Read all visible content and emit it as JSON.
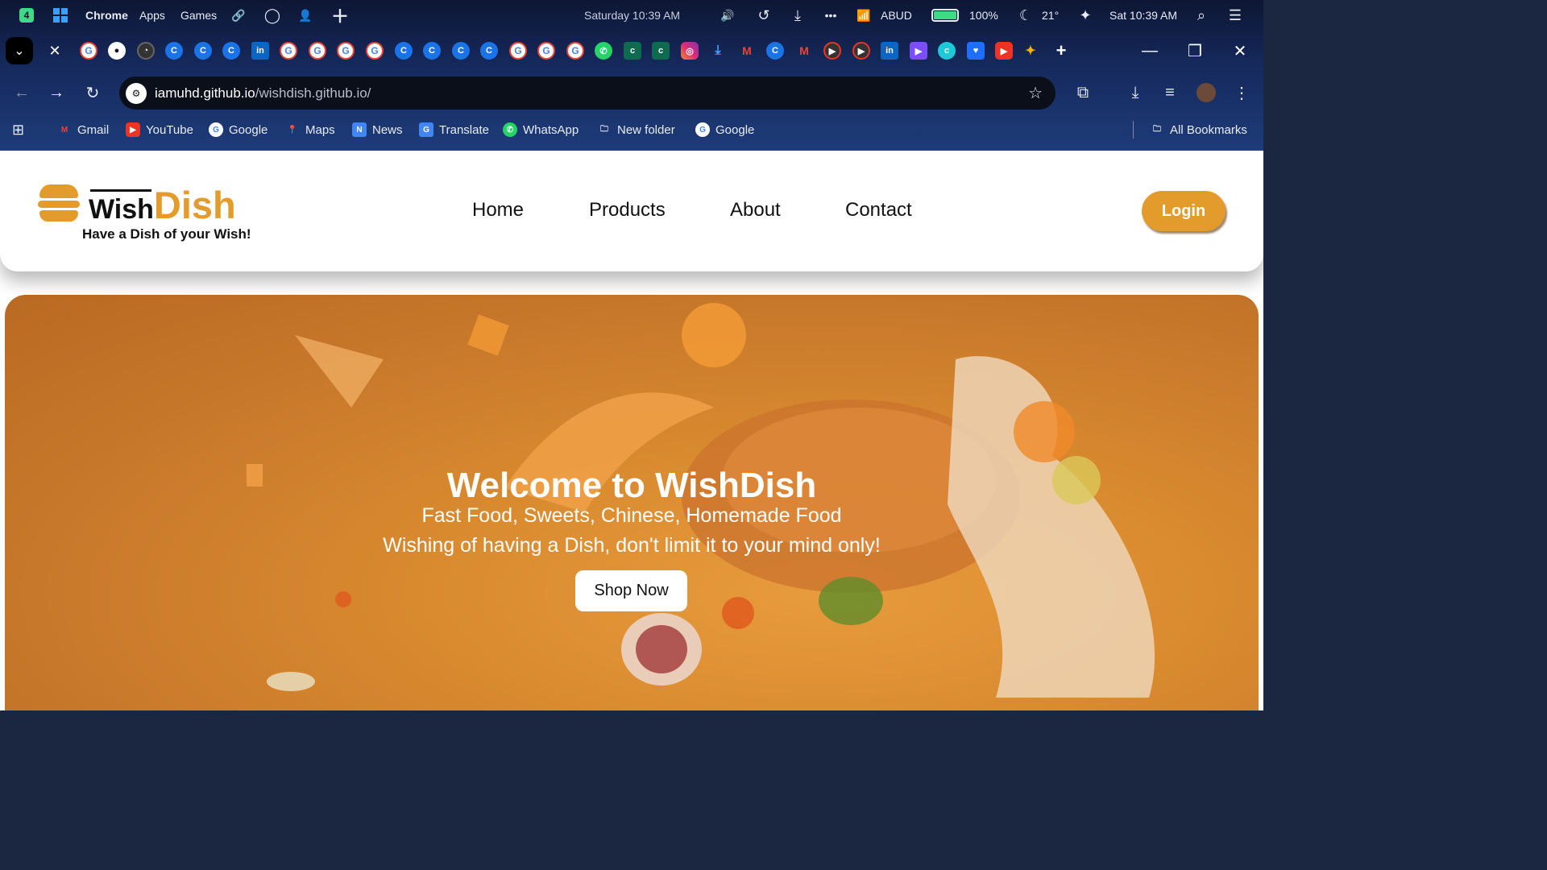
{
  "os": {
    "badge": "4",
    "browser_name": "Chrome",
    "menu_apps": "Apps",
    "menu_games": "Games",
    "center_time": "Saturday 10:39 AM",
    "network_name": "ABUD",
    "battery": "100%",
    "temperature": "21°",
    "clock": "Sat 10:39 AM"
  },
  "tabs": {
    "favicons": [
      "G",
      "github",
      "clock",
      "C",
      "C",
      "C",
      "in",
      "G",
      "G",
      "G",
      "G",
      "C",
      "C",
      "C",
      "C",
      "G",
      "G",
      "G",
      "whatsapp",
      "cg",
      "cg",
      "instagram",
      "download",
      "gmail",
      "C",
      "gmail",
      "youtube",
      "youtube",
      "in",
      "play",
      "canva",
      "heart",
      "youtube",
      "gemini"
    ]
  },
  "address": {
    "domain": "iamuhd.github.io",
    "path": "/wishdish.github.io/"
  },
  "bookmarks": {
    "items": [
      {
        "label": "Gmail",
        "icon": "gmail-icon"
      },
      {
        "label": "YouTube",
        "icon": "youtube-icon"
      },
      {
        "label": "Google",
        "icon": "google-icon"
      },
      {
        "label": "Maps",
        "icon": "maps-icon"
      },
      {
        "label": "News",
        "icon": "news-icon"
      },
      {
        "label": "Translate",
        "icon": "translate-icon"
      },
      {
        "label": "WhatsApp",
        "icon": "whatsapp-icon"
      },
      {
        "label": "New folder",
        "icon": "folder-icon"
      },
      {
        "label": "Google",
        "icon": "google-icon"
      }
    ],
    "all": "All Bookmarks"
  },
  "site": {
    "brand_wish": "Wish",
    "brand_dish": "Dish",
    "tagline": "Have a Dish of your Wish!",
    "nav": [
      "Home",
      "Products",
      "About",
      "Contact"
    ],
    "login": "Login",
    "hero_title": "Welcome to WishDish",
    "hero_sub": "Fast Food, Sweets, Chinese, Homemade Food",
    "hero_tag": "Wishing of having a Dish, don't limit it to your mind only!",
    "shop": "Shop Now"
  },
  "colors": {
    "accent": "#e39b2c",
    "hero": "#d98a2f"
  }
}
